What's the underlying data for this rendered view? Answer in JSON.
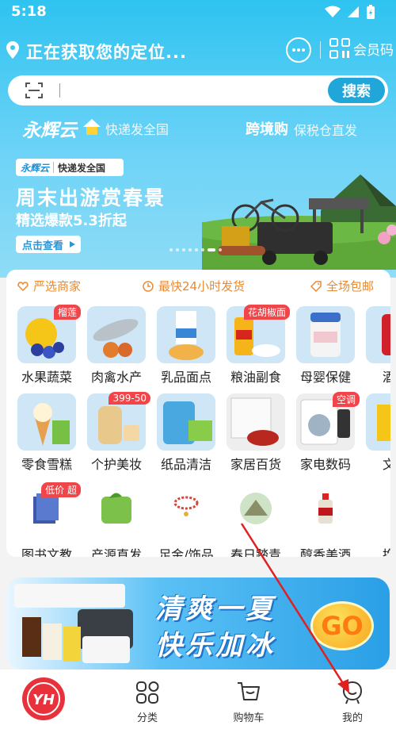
{
  "status_bar": {
    "time": "5:18"
  },
  "header": {
    "location_text": "正在获取您的定位...",
    "member_code_label": "会员码"
  },
  "search": {
    "button_label": "搜索"
  },
  "brand_row": {
    "logo_text": "永辉云",
    "logo_sub": "快递发全国",
    "cross_title": "跨境购",
    "cross_sub": "保税仓直发"
  },
  "banner": {
    "tag_logo": "永辉云",
    "tag_text": "快递发全国",
    "title": "周末出游赏春景",
    "subtitle": "精选爆款5.3折起",
    "cta_label": "点击查看",
    "slide_count": 8,
    "active_slide": 6
  },
  "guarantees": {
    "item1": "严选商家",
    "item2": "最快24小时发货",
    "item3": "全场包邮"
  },
  "categories": {
    "c0": {
      "label": "水果蔬菜",
      "badge": "榴莲"
    },
    "c1": {
      "label": "肉禽水产"
    },
    "c2": {
      "label": "乳品面点"
    },
    "c3": {
      "label": "粮油副食",
      "badge": "花胡椒面"
    },
    "c4": {
      "label": "母婴保健"
    },
    "c5": {
      "label": "酒水"
    },
    "c6": {
      "label": "零食雪糕"
    },
    "c7": {
      "label": "个护美妆",
      "badge": "399-50"
    },
    "c8": {
      "label": "纸品清洁"
    },
    "c9": {
      "label": "家居百货"
    },
    "c10": {
      "label": "家电数码",
      "badge": "空调"
    },
    "c11": {
      "label": "文体"
    },
    "c12": {
      "label": "图书文教",
      "badge": "低价 超"
    },
    "c13": {
      "label": "产源直发"
    },
    "c14": {
      "label": "足金/饰品"
    },
    "c15": {
      "label": "春日踏青"
    },
    "c16": {
      "label": "醇香美酒"
    },
    "c17": {
      "label": "换季"
    }
  },
  "promo": {
    "line1": "清爽一夏",
    "line2": "快乐加冰",
    "go_label": "GO"
  },
  "tabbar": {
    "home_logo": "YH",
    "t1": "分类",
    "t2": "购物车",
    "t3": "我的"
  },
  "colors": {
    "accent": "#21a6d9",
    "header_top": "#2ec3f0",
    "badge_red": "#f0464a",
    "guarantee_orange": "#e88a33",
    "home_red": "#e8313a",
    "annotation_arrow": "#e02020"
  }
}
